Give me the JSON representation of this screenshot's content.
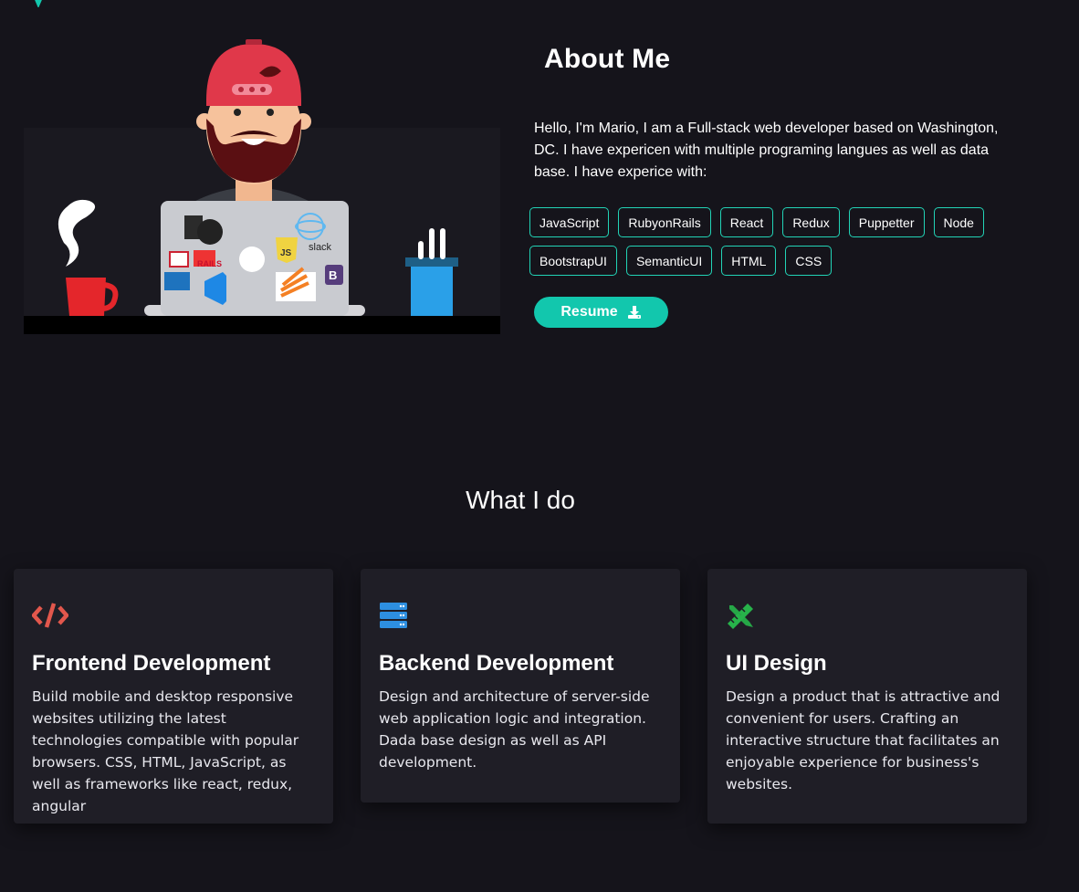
{
  "colors": {
    "background": "#15141b",
    "accent": "#12c7ad",
    "card_background": "#1f1e26",
    "frontend_icon": "#e2574c",
    "backend_icon": "#2d8fe0",
    "design_icon": "#27b34a"
  },
  "about": {
    "title": "About Me",
    "text": "Hello, I'm Mario, I am a Full-stack web developer based on Washington, DC. I have expericen with multiple programing langues as well as data base. I have experice with:",
    "skills": [
      "JavaScript",
      "RubyonRails",
      "React",
      "Redux",
      "Puppetter",
      "Node",
      "BootstrapUI",
      "SemanticUI",
      "HTML",
      "CSS"
    ],
    "resume_label": "Resume",
    "resume_icon": "download-icon"
  },
  "illustration": {
    "laptop_stickers": [
      "RAILS",
      "slack",
      "JS",
      "B"
    ]
  },
  "services": {
    "title": "What I do",
    "cards": [
      {
        "icon": "code-icon",
        "title": "Frontend Development",
        "text": "Build mobile and desktop responsive websites utilizing the latest technologies compatible with popular browsers. CSS, HTML, JavaScript, as well as frameworks like react, redux, angular"
      },
      {
        "icon": "server-icon",
        "title": "Backend Development",
        "text": "Design and architecture of server-side web application logic and integration. Dada base design as well as API development."
      },
      {
        "icon": "pencil-ruler-icon",
        "title": "UI Design",
        "text": "Design a product that is attractive and convenient for users. Crafting an interactive structure that facilitates an enjoyable experience for business's websites."
      }
    ]
  }
}
